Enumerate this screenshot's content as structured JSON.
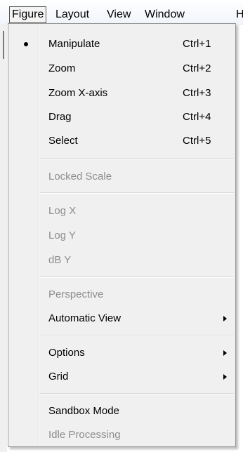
{
  "menubar": {
    "items": [
      {
        "label": "Figure"
      },
      {
        "label": "Layout"
      },
      {
        "label": "View"
      },
      {
        "label": "Window"
      },
      {
        "label": "H"
      }
    ]
  },
  "menu": {
    "items": [
      {
        "label": "Manipulate",
        "shortcut": "Ctrl+1",
        "checked": true
      },
      {
        "label": "Zoom",
        "shortcut": "Ctrl+2"
      },
      {
        "label": "Zoom X-axis",
        "shortcut": "Ctrl+3"
      },
      {
        "label": "Drag",
        "shortcut": "Ctrl+4"
      },
      {
        "label": "Select",
        "shortcut": "Ctrl+5"
      },
      {
        "label": "Locked Scale",
        "disabled": true
      },
      {
        "label": "Log X",
        "disabled": true
      },
      {
        "label": "Log Y",
        "disabled": true
      },
      {
        "label": "dB Y",
        "disabled": true
      },
      {
        "label": "Perspective",
        "disabled": true
      },
      {
        "label": "Automatic View",
        "submenu": true
      },
      {
        "label": "Options",
        "submenu": true
      },
      {
        "label": "Grid",
        "submenu": true
      },
      {
        "label": "Sandbox Mode"
      },
      {
        "label": "Idle Processing",
        "disabled": true
      }
    ]
  }
}
